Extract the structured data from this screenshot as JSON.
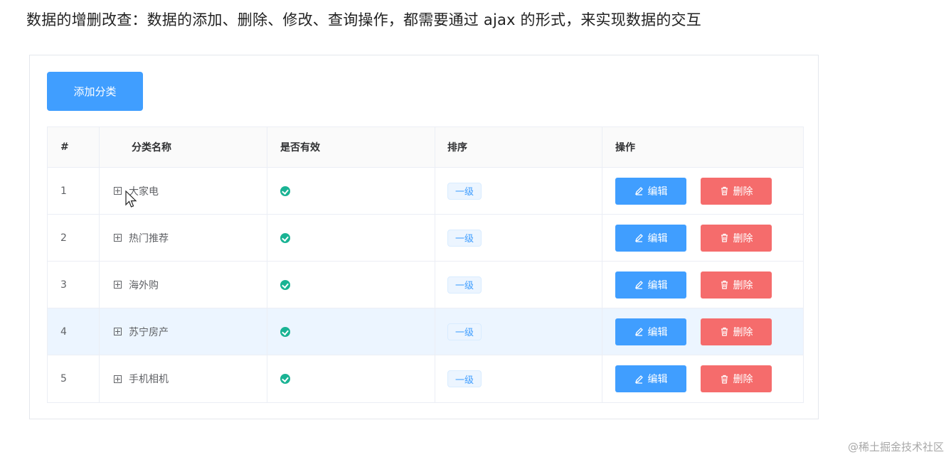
{
  "heading": "数据的增删改查：数据的添加、删除、修改、查询操作，都需要通过 ajax 的形式，来实现数据的交互",
  "add_button": "添加分类",
  "table": {
    "headers": [
      "#",
      "分类名称",
      "是否有效",
      "排序",
      "操作"
    ],
    "rows": [
      {
        "index": "1",
        "name": "大家电",
        "level": "一级"
      },
      {
        "index": "2",
        "name": "热门推荐",
        "level": "一级"
      },
      {
        "index": "3",
        "name": "海外购",
        "level": "一级"
      },
      {
        "index": "4",
        "name": "苏宁房产",
        "level": "一级"
      },
      {
        "index": "5",
        "name": "手机相机",
        "level": "一级"
      }
    ],
    "edit_label": "编辑",
    "delete_label": "删除",
    "hover_row": 4,
    "valid_icon": "check-circle-icon"
  },
  "watermark": "@稀土掘金技术社区",
  "colors": {
    "primary": "#409eff",
    "danger": "#f56c6c",
    "success": "#1ab394",
    "hover_row_bg": "#ecf5ff"
  }
}
